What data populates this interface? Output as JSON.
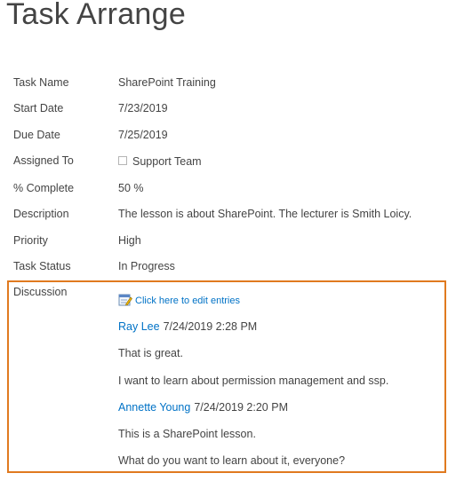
{
  "page": {
    "title": "Task Arrange"
  },
  "fields": {
    "task_name": {
      "label": "Task Name",
      "value": "SharePoint Training"
    },
    "start_date": {
      "label": "Start Date",
      "value": "7/23/2019"
    },
    "due_date": {
      "label": "Due Date",
      "value": "7/25/2019"
    },
    "assigned_to": {
      "label": "Assigned To",
      "value": "Support Team"
    },
    "percent_complete": {
      "label": "% Complete",
      "value": "50 %"
    },
    "description": {
      "label": "Description",
      "value": "The lesson is about SharePoint. The lecturer is Smith Loicy."
    },
    "priority": {
      "label": "Priority",
      "value": "High"
    },
    "task_status": {
      "label": "Task Status",
      "value": "In Progress"
    }
  },
  "discussion": {
    "label": "Discussion",
    "edit_link": "Click here to edit entries",
    "highlight_color": "#e07a1f",
    "link_color": "#0072c6",
    "entries": [
      {
        "author": "Ray Lee",
        "timestamp": "7/24/2019 2:28 PM",
        "lines": [
          "That is great.",
          "I want to learn about permission management and ssp."
        ]
      },
      {
        "author": "Annette Young",
        "timestamp": "7/24/2019 2:20 PM",
        "lines": [
          "This is a SharePoint lesson.",
          "What do you want to learn about it, everyone?"
        ]
      }
    ]
  },
  "icons": {
    "edit_entries": "edit-entries-icon",
    "assigned_presence": "presence-checkbox-icon"
  }
}
